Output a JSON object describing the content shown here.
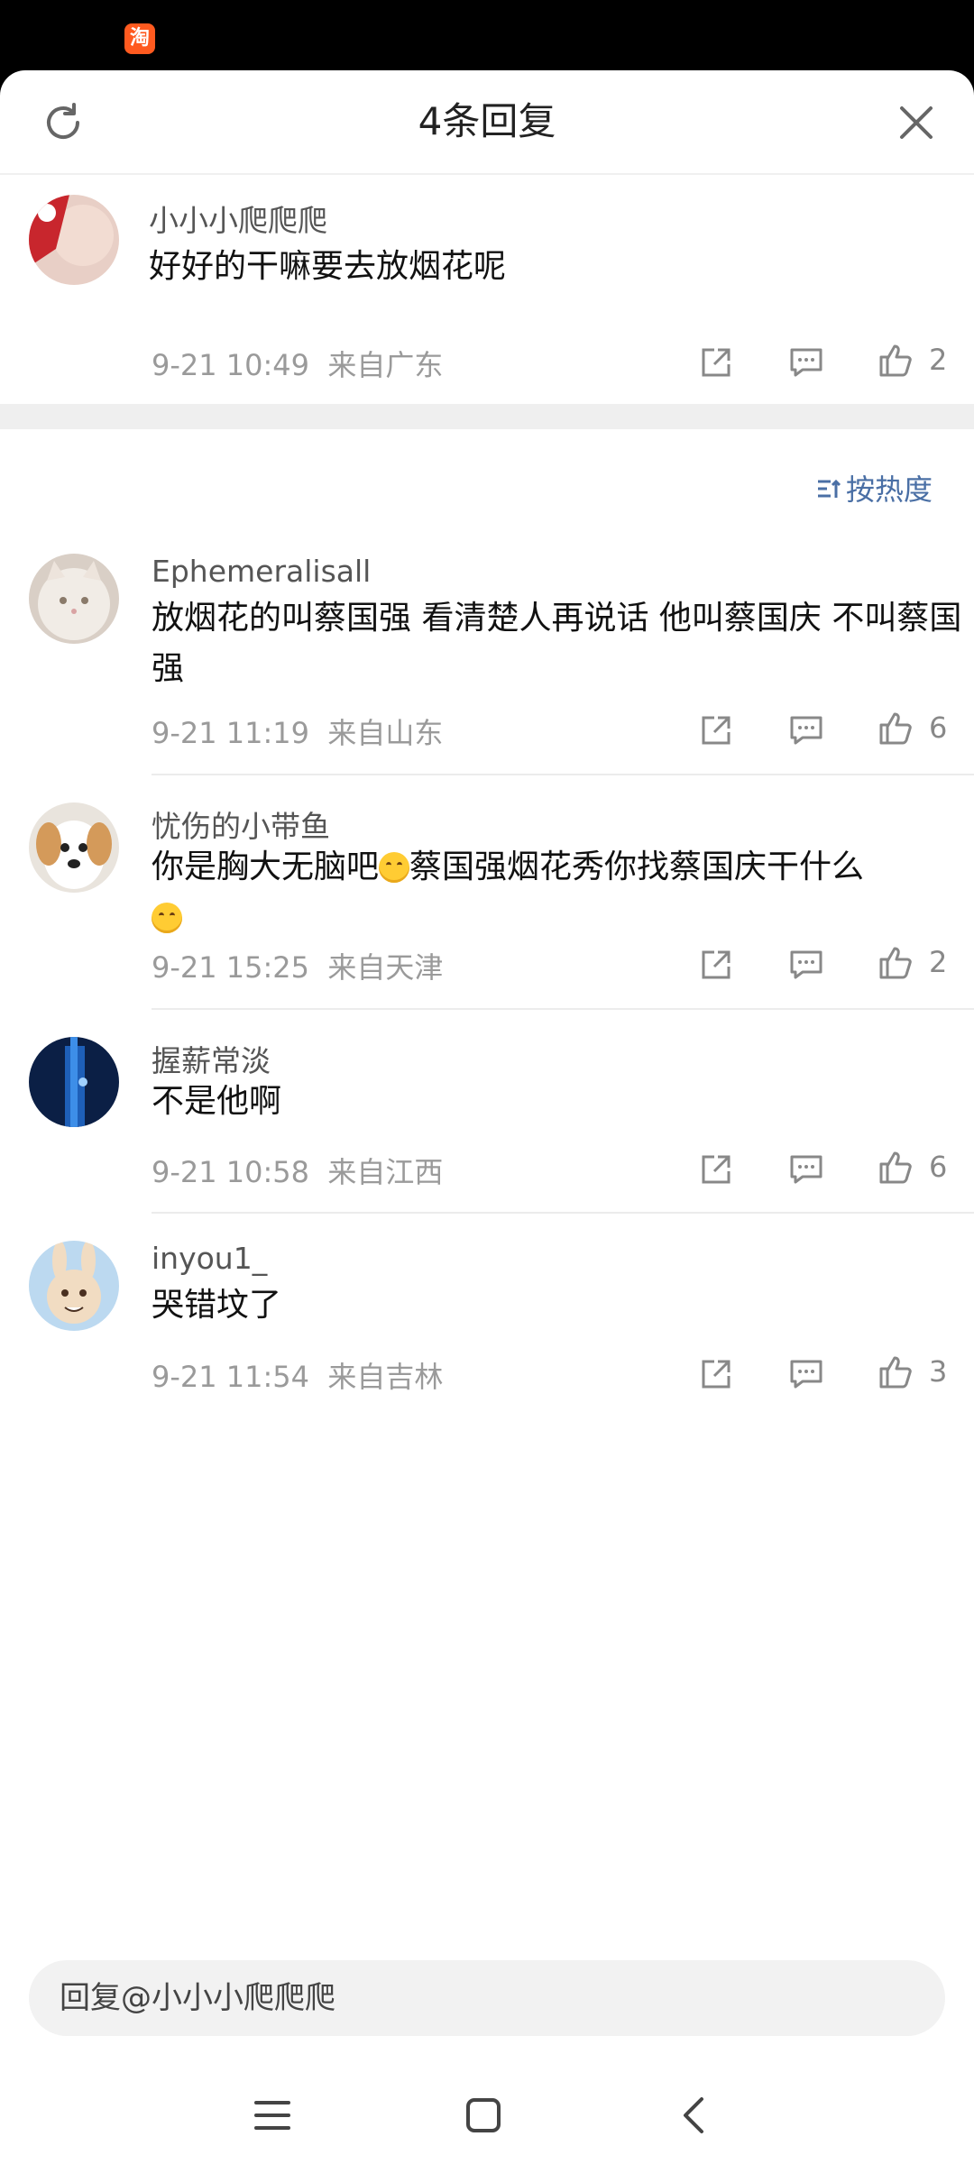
{
  "header": {
    "title": "4条回复"
  },
  "original_comment": {
    "username": "小小小爬爬爬",
    "text": "好好的干嘛要去放烟花呢",
    "time": "9-21 10:49",
    "location": "来自广东",
    "likes": "2"
  },
  "sort_label": "按热度",
  "replies": [
    {
      "username": "Ephemeralisall",
      "text": "放烟花的叫蔡国强 看清楚人再说话 他叫蔡国庆 不叫蔡国强",
      "time": "9-21 11:19",
      "location": "来自山东",
      "likes": "6"
    },
    {
      "username": "忧伤的小带鱼",
      "text_a": "你是胸大无脑吧",
      "text_b": "蔡国强烟花秀你找蔡国庆干什么",
      "time": "9-21 15:25",
      "location": "来自天津",
      "likes": "2"
    },
    {
      "username": "握薪常淡",
      "text": "不是他啊",
      "time": "9-21 10:58",
      "location": "来自江西",
      "likes": "6"
    },
    {
      "username": "inyou1_",
      "text": "哭错坟了",
      "time": "9-21 11:54",
      "location": "来自吉林",
      "likes": "3"
    }
  ],
  "reply_input": {
    "placeholder": "回复@小小小爬爬爬"
  },
  "status_bar": {
    "app_icon": "淘"
  },
  "icons": {
    "share": "share-icon",
    "comment": "comment-icon",
    "like": "thumbs-up-icon"
  }
}
